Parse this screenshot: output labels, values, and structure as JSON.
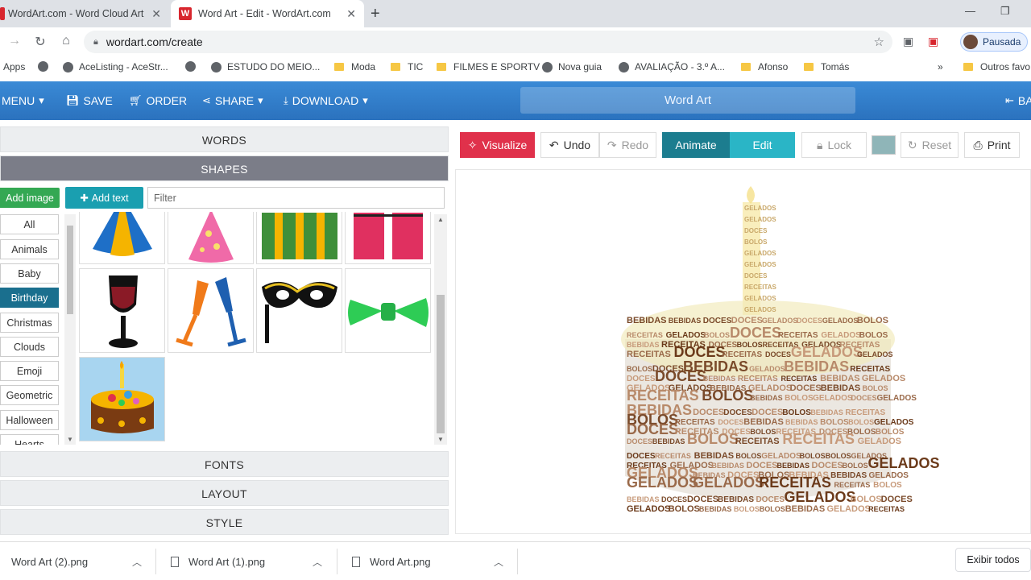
{
  "browser": {
    "tabs": [
      {
        "title": "WordArt.com - Word Cloud Art C",
        "active": false
      },
      {
        "title": "Word Art - Edit - WordArt.com",
        "active": true
      }
    ],
    "url": "wordart.com/create",
    "profile": "Pausada",
    "bookmarks": [
      {
        "label": "Apps",
        "icon": "apps-icon"
      },
      {
        "label": "",
        "icon": "globe-icon"
      },
      {
        "label": "AceListing - AceStr...",
        "icon": "globe-icon"
      },
      {
        "label": "ESTUDO DO MEIO...",
        "icon": "globe-icon"
      },
      {
        "label": "Moda",
        "icon": "folder-icon"
      },
      {
        "label": "TIC",
        "icon": "folder-icon"
      },
      {
        "label": "FILMES E SPORTV",
        "icon": "folder-icon"
      },
      {
        "label": "Nova guia",
        "icon": "globe-icon"
      },
      {
        "label": "AVALIAÇÃO - 3.º A...",
        "icon": "globe-icon"
      },
      {
        "label": "Afonso",
        "icon": "folder-icon"
      },
      {
        "label": "Tomás",
        "icon": "folder-icon"
      },
      {
        "label": "»",
        "icon": ""
      },
      {
        "label": "Outros favo",
        "icon": "folder-icon"
      }
    ]
  },
  "header": {
    "menu": "MENU",
    "save": "SAVE",
    "order": "ORDER",
    "share": "SHARE",
    "download": "DOWNLOAD",
    "title": "Word Art",
    "back": "BA"
  },
  "panel": {
    "sections": {
      "words": "WORDS",
      "shapes": "SHAPES",
      "fonts": "FONTS",
      "layout": "LAYOUT",
      "style": "STYLE"
    },
    "add_image": "Add image",
    "add_text": "Add text",
    "filter_placeholder": "Filter",
    "categories": [
      "All",
      "Animals",
      "Baby",
      "Birthday",
      "Christmas",
      "Clouds",
      "Emoji",
      "Geometric",
      "Halloween",
      "Hearts"
    ],
    "selected_category": "Birthday",
    "shapes": [
      "party-hat-blue",
      "party-hat-pink",
      "gift-box-green",
      "gift-box-red",
      "wine-glass",
      "champagne-glasses",
      "party-mask",
      "bow-tie",
      "birthday-cake"
    ]
  },
  "toolbar": {
    "visualize": "Visualize",
    "undo": "Undo",
    "redo": "Redo",
    "animate": "Animate",
    "edit": "Edit",
    "lock": "Lock",
    "reset": "Reset",
    "print": "Print",
    "swatch_color": "#8fb5b8"
  },
  "canvas": {
    "words": [
      "DOCES",
      "BOLOS",
      "GELADOS",
      "BEBIDAS",
      "RECEITAS"
    ]
  },
  "downloads": {
    "items": [
      "Word Art (2).png",
      "Word Art (1).png",
      "Word Art.png"
    ],
    "show_all": "Exibir todos"
  }
}
